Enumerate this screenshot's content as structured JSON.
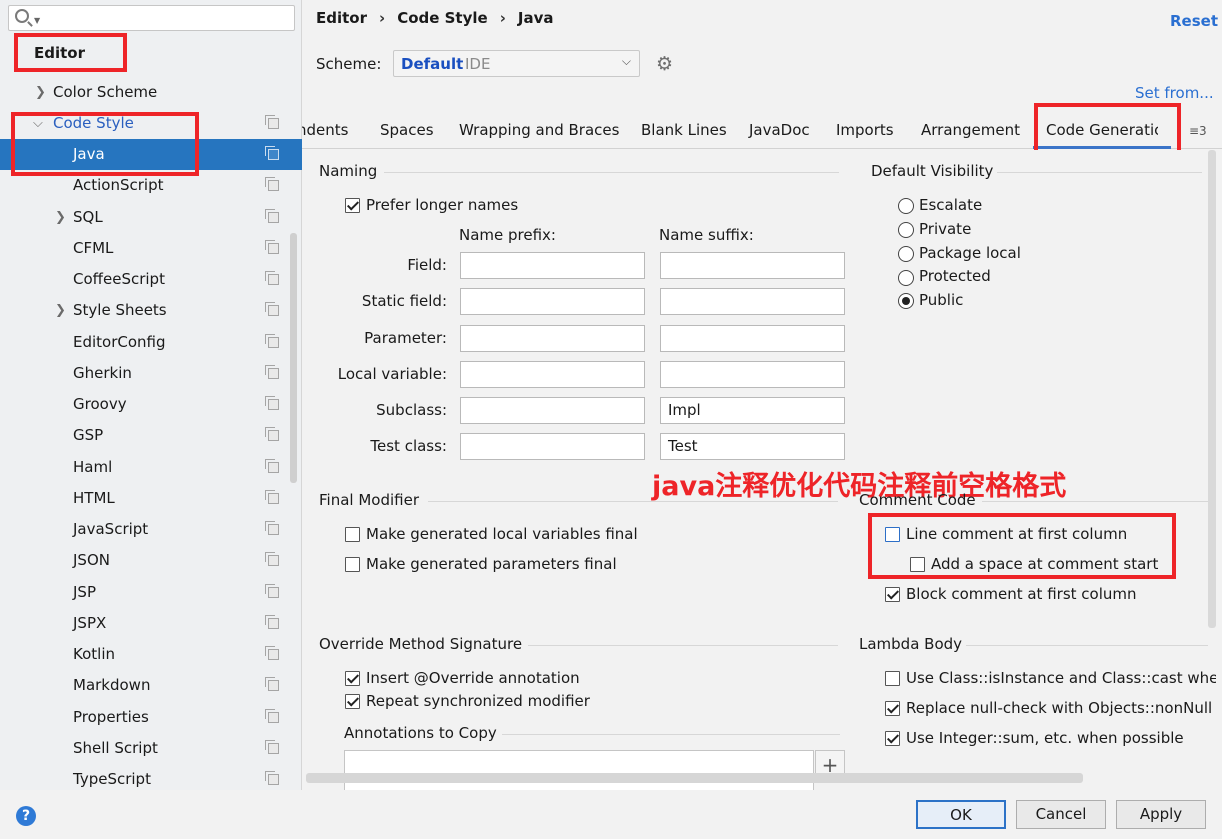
{
  "sidebar": {
    "search_placeholder": "",
    "items": [
      {
        "label": "Editor",
        "id": "editor"
      },
      {
        "label": "Color Scheme",
        "id": "color-scheme"
      },
      {
        "label": "Code Style",
        "id": "code-style"
      },
      {
        "label": "Java",
        "id": "java"
      },
      {
        "label": "ActionScript",
        "id": "actionscript"
      },
      {
        "label": "SQL",
        "id": "sql"
      },
      {
        "label": "CFML",
        "id": "cfml"
      },
      {
        "label": "CoffeeScript",
        "id": "coffeescript"
      },
      {
        "label": "Style Sheets",
        "id": "style-sheets"
      },
      {
        "label": "EditorConfig",
        "id": "editorconfig"
      },
      {
        "label": "Gherkin",
        "id": "gherkin"
      },
      {
        "label": "Groovy",
        "id": "groovy"
      },
      {
        "label": "GSP",
        "id": "gsp"
      },
      {
        "label": "Haml",
        "id": "haml"
      },
      {
        "label": "HTML",
        "id": "html"
      },
      {
        "label": "JavaScript",
        "id": "javascript"
      },
      {
        "label": "JSON",
        "id": "json"
      },
      {
        "label": "JSP",
        "id": "jsp"
      },
      {
        "label": "JSPX",
        "id": "jspx"
      },
      {
        "label": "Kotlin",
        "id": "kotlin"
      },
      {
        "label": "Markdown",
        "id": "markdown"
      },
      {
        "label": "Properties",
        "id": "properties"
      },
      {
        "label": "Shell Script",
        "id": "shell-script"
      },
      {
        "label": "TypeScript",
        "id": "typescript"
      }
    ]
  },
  "header": {
    "breadcrumb": [
      "Editor",
      "Code Style",
      "Java"
    ],
    "reset_label": "Reset",
    "scheme_label": "Scheme:",
    "scheme_name": "Default",
    "scheme_sub": "IDE",
    "set_from_label": "Set from..."
  },
  "tabs": [
    "ndents",
    "Spaces",
    "Wrapping and Braces",
    "Blank Lines",
    "JavaDoc",
    "Imports",
    "Arrangement",
    "Code Generatic"
  ],
  "tabs_more": "≡3",
  "naming": {
    "title": "Naming",
    "prefer_longer": "Prefer longer names",
    "prefix_header": "Name prefix:",
    "suffix_header": "Name suffix:",
    "rows": [
      {
        "label": "Field:",
        "prefix": "",
        "suffix": ""
      },
      {
        "label": "Static field:",
        "prefix": "",
        "suffix": ""
      },
      {
        "label": "Parameter:",
        "prefix": "",
        "suffix": ""
      },
      {
        "label": "Local variable:",
        "prefix": "",
        "suffix": ""
      },
      {
        "label": "Subclass:",
        "prefix": "",
        "suffix": "Impl"
      },
      {
        "label": "Test class:",
        "prefix": "",
        "suffix": "Test"
      }
    ]
  },
  "visibility": {
    "title": "Default Visibility",
    "options": [
      "Escalate",
      "Private",
      "Package local",
      "Protected",
      "Public"
    ],
    "selected": "Public"
  },
  "final_modifier": {
    "title": "Final Modifier",
    "local_vars": "Make generated local variables final",
    "params": "Make generated parameters final"
  },
  "comment_code": {
    "title": "Comment Code",
    "line_first": "Line comment at first column",
    "add_space": "Add a space at comment start",
    "block_first": "Block comment at first column"
  },
  "override": {
    "title": "Override Method Signature",
    "insert_override": "Insert @Override annotation",
    "repeat_sync": "Repeat synchronized modifier",
    "annotations_title": "Annotations to Copy"
  },
  "lambda": {
    "title": "Lambda Body",
    "isinstance": "Use Class::isInstance and Class::cast when po",
    "nonnull": "Replace null-check with Objects::nonNull or",
    "integer_sum": "Use Integer::sum, etc. when possible"
  },
  "annotation_overlay": "java注释优化代码注释前空格格式",
  "buttons": {
    "ok": "OK",
    "cancel": "Cancel",
    "apply": "Apply",
    "help": "?"
  },
  "colors": {
    "accent": "#2675bf",
    "highlight_red": "#ee2428",
    "link": "#2a6fd1"
  }
}
